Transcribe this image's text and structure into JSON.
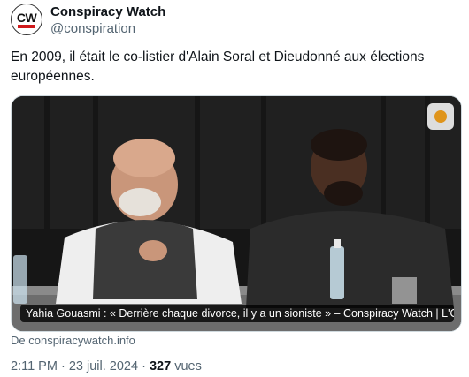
{
  "author": {
    "avatar_text": "CW",
    "name": "Conspiracy Watch",
    "handle": "@conspiration"
  },
  "tweet": {
    "text": "En 2009, il était le co-listier d'Alain Soral et Dieudonné aux élections européennes."
  },
  "media": {
    "caption": "Yahia Gouasmi : « Derrière chaque divorce, il y a un sioniste » – Conspiracy Watch | L'Ob...",
    "source": "De conspiracywatch.info"
  },
  "meta": {
    "time": "2:11 PM",
    "separator": "·",
    "date": "23 juil. 2024",
    "views_count": "327",
    "views_label": "vues"
  },
  "colors": {
    "text": "#0f1419",
    "secondary": "#536471",
    "border": "#cfd9de",
    "brand_red": "#d0191b"
  }
}
